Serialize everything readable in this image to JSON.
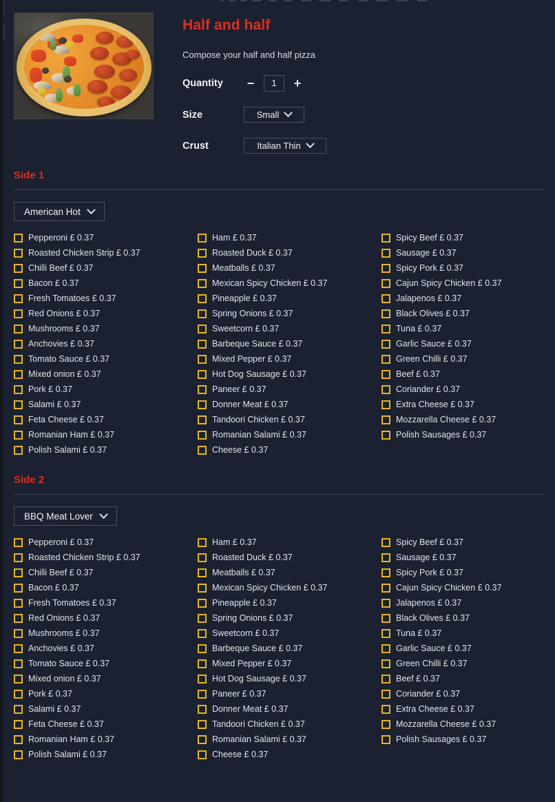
{
  "product": {
    "title": "Half and half",
    "description": "Compose your half and half pizza",
    "image_alt": "half-and-half-pizza-photo"
  },
  "options": {
    "quantity_label": "Quantity",
    "quantity_value": "1",
    "decrement_label": "−",
    "increment_label": "+",
    "size_label": "Size",
    "size_value": "Small",
    "crust_label": "Crust",
    "crust_value": "Italian Thin"
  },
  "colors": {
    "accent_red": "#dc2f1f",
    "checkbox_gold": "#e8b622",
    "panel_bg": "#1b2130",
    "text": "#dfe4eb",
    "border": "#4b5160"
  },
  "sides": [
    {
      "heading": "Side 1",
      "base_value": "American Hot",
      "columns": [
        [
          "Pepperoni £ 0.37",
          "Roasted Chicken Strip £ 0.37",
          "Chilli Beef £ 0.37",
          "Bacon £ 0.37",
          "Fresh Tomatoes £ 0.37",
          "Red Onions £ 0.37",
          "Mushrooms £ 0.37",
          "Anchovies £ 0.37",
          "Tomato Sauce £ 0.37",
          "Mixed onion £ 0.37",
          "Pork £ 0.37",
          "Salami £ 0.37",
          "Feta Cheese £ 0.37",
          "Romanian Ham £ 0.37",
          "Polish Salami £ 0.37"
        ],
        [
          "Ham £ 0.37",
          "Roasted Duck £ 0.37",
          "Meatballs £ 0.37",
          "Mexican Spicy Chicken £ 0.37",
          "Pineapple £ 0.37",
          "Spring Onions £ 0.37",
          "Sweetcorn £ 0.37",
          "Barbeque Sauce £ 0.37",
          "Mixed Pepper £ 0.37",
          "Hot Dog Sausage £ 0.37",
          "Paneer £ 0.37",
          "Donner Meat £ 0.37",
          "Tandoori Chicken £ 0.37",
          "Romanian Salami £ 0.37",
          "Cheese £ 0.37"
        ],
        [
          "Spicy Beef £ 0.37",
          "Sausage £ 0.37",
          "Spicy Pork £ 0.37",
          "Cajun Spicy Chicken £ 0.37",
          "Jalapenos £ 0.37",
          "Black Olives £ 0.37",
          "Tuna £ 0.37",
          "Garlic Sauce £ 0.37",
          "Green Chilli £ 0.37",
          "Beef £ 0.37",
          "Coriander £ 0.37",
          "Extra Cheese £ 0.37",
          "Mozzarella Cheese £ 0.37",
          "Polish Sausages £ 0.37"
        ]
      ]
    },
    {
      "heading": "Side 2",
      "base_value": "BBQ Meat Lover",
      "columns": [
        [
          "Pepperoni £ 0.37",
          "Roasted Chicken Strip £ 0.37",
          "Chilli Beef £ 0.37",
          "Bacon £ 0.37",
          "Fresh Tomatoes £ 0.37",
          "Red Onions £ 0.37",
          "Mushrooms £ 0.37",
          "Anchovies £ 0.37",
          "Tomato Sauce £ 0.37",
          "Mixed onion £ 0.37",
          "Pork £ 0.37",
          "Salami £ 0.37",
          "Feta Cheese £ 0.37",
          "Romanian Ham £ 0.37",
          "Polish Salami £ 0.37"
        ],
        [
          "Ham £ 0.37",
          "Roasted Duck £ 0.37",
          "Meatballs £ 0.37",
          "Mexican Spicy Chicken £ 0.37",
          "Pineapple £ 0.37",
          "Spring Onions £ 0.37",
          "Sweetcorn £ 0.37",
          "Barbeque Sauce £ 0.37",
          "Mixed Pepper £ 0.37",
          "Hot Dog Sausage £ 0.37",
          "Paneer £ 0.37",
          "Donner Meat £ 0.37",
          "Tandoori Chicken £ 0.37",
          "Romanian Salami £ 0.37",
          "Cheese £ 0.37"
        ],
        [
          "Spicy Beef £ 0.37",
          "Sausage £ 0.37",
          "Spicy Pork £ 0.37",
          "Cajun Spicy Chicken £ 0.37",
          "Jalapenos £ 0.37",
          "Black Olives £ 0.37",
          "Tuna £ 0.37",
          "Garlic Sauce £ 0.37",
          "Green Chilli £ 0.37",
          "Beef £ 0.37",
          "Coriander £ 0.37",
          "Extra Cheese £ 0.37",
          "Mozzarella Cheese £ 0.37",
          "Polish Sausages £ 0.37"
        ]
      ]
    }
  ]
}
